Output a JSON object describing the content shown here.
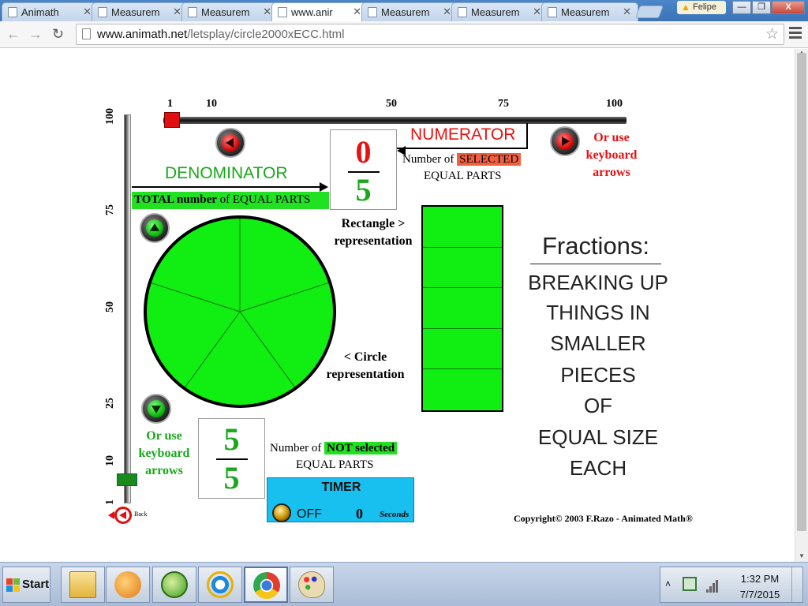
{
  "browser": {
    "tabs": [
      {
        "label": "Animath",
        "active": false
      },
      {
        "label": "Measurem",
        "active": false
      },
      {
        "label": "Measurem",
        "active": false
      },
      {
        "label": "www.anir",
        "active": true
      },
      {
        "label": "Measurem",
        "active": false
      },
      {
        "label": "Measurem",
        "active": false
      },
      {
        "label": "Measurem",
        "active": false
      }
    ],
    "user": "Felipe",
    "url_domain": "www.animath.net",
    "url_path": "/letsplay/circle2000xECC.html",
    "window_buttons": {
      "minimize": "—",
      "maximize": "❐",
      "close": "X"
    }
  },
  "app": {
    "h_ticks": [
      "1",
      "10",
      "50",
      "75",
      "100"
    ],
    "v_ticks": [
      "100",
      "75",
      "50",
      "25",
      "10",
      "1"
    ],
    "numerator_label": "NUMERATOR",
    "numerator_desc_pre": "Number of",
    "numerator_desc_highlight": "SELECTED",
    "numerator_desc_post": "EQUAL PARTS",
    "keyboard_hint_right": [
      "Or use",
      "keyboard",
      "arrows"
    ],
    "denominator_label": "DENOMINATOR",
    "total_parts_bold": "TOTAL number",
    "total_parts_rest": " of  EQUAL PARTS",
    "fraction": {
      "numerator": "0",
      "denominator": "5"
    },
    "remaining_fraction": {
      "numerator": "5",
      "denominator": "5"
    },
    "rect_label": [
      "Rectangle  >",
      "representation"
    ],
    "circle_label": [
      "<  Circle",
      "representation"
    ],
    "keyboard_hint_left": [
      "Or use",
      "keyboard",
      "arrows"
    ],
    "notsel_pre": "Number of",
    "notsel_highlight": "NOT selected",
    "notsel_post": "EQUAL PARTS",
    "timer": {
      "title": "TIMER",
      "state": "OFF",
      "value": "0",
      "unit": "Seconds"
    },
    "back_label": "Back",
    "title": "Fractions:",
    "blurb": [
      "BREAKING UP",
      "THINGS IN",
      "SMALLER",
      "PIECES",
      "OF",
      "EQUAL SIZE",
      "EACH"
    ],
    "copyright": "Copyright© 2003  F.Razo - Animated Math®",
    "parts_total": 5,
    "parts_selected": 0,
    "colors": {
      "part_fill": "#11ee11",
      "numerator": "#e81010",
      "denominator": "#1aa81a",
      "timer_bg": "#18c0f0"
    }
  },
  "taskbar": {
    "start_label": "Start",
    "items": [
      "folder",
      "media-player",
      "green-app",
      "internet-explorer",
      "chrome",
      "paint"
    ],
    "time": "1:32 PM",
    "date": "7/7/2015"
  }
}
